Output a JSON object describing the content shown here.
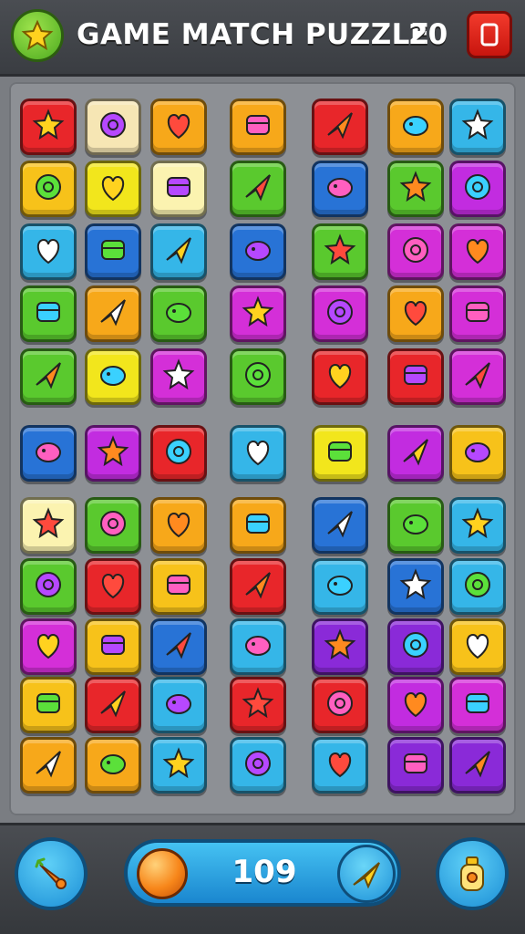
{
  "header": {
    "title": "GAME MATCH PUZZLE",
    "score": "20",
    "star_icon": "star-icon",
    "menu_icon": "menu-icon"
  },
  "footer": {
    "coins": "109",
    "left_button_icon": "carrot-icon",
    "orb_icon": "orange-orb-icon",
    "send_icon": "paper-plane-icon",
    "right_button_icon": "potion-bottle-icon"
  },
  "board": {
    "rows": 11,
    "cols": 7,
    "tiles": [
      [
        {
          "bg": "#e8262a",
          "icon": "blue-star-shard"
        },
        {
          "bg": "#f6e6b4",
          "icon": "map-piece"
        },
        {
          "bg": "#f7a81a",
          "icon": "orange-splat"
        },
        {
          "bg": "#f7a81a",
          "icon": "red-gem"
        },
        {
          "bg": "#e8262a",
          "icon": "folded-paper"
        },
        {
          "bg": "#f7a81a",
          "icon": "fox-head"
        },
        {
          "bg": "#35b6e8",
          "icon": "paint-brush"
        }
      ],
      [
        {
          "bg": "#f7c21a",
          "icon": "orange-star"
        },
        {
          "bg": "#f2e61c",
          "icon": "balloons"
        },
        {
          "bg": "#fbf3b0",
          "icon": "white-star"
        },
        {
          "bg": "#5ac92e",
          "icon": "red-button"
        },
        {
          "bg": "#2873d6",
          "icon": "red-leaf"
        },
        {
          "bg": "#5ac92e",
          "icon": "purple-heart"
        },
        {
          "bg": "#c22ce0",
          "icon": "orange-blob"
        }
      ],
      [
        {
          "bg": "#35b6e8",
          "icon": "cloud"
        },
        {
          "bg": "#2873d6",
          "icon": "wheel"
        },
        {
          "bg": "#35b6e8",
          "icon": "sun"
        },
        {
          "bg": "#2873d6",
          "icon": "bird"
        },
        {
          "bg": "#5ac92e",
          "icon": "ping-pong-paddle"
        },
        {
          "bg": "#d42fd8",
          "icon": "trumpet"
        },
        {
          "bg": "#d42fd8",
          "icon": "orange-slice"
        }
      ],
      [
        {
          "bg": "#5ac92e",
          "icon": "green-balloon"
        },
        {
          "bg": "#f7a81a",
          "icon": "pink-cone"
        },
        {
          "bg": "#5ac92e",
          "icon": "red-star"
        },
        {
          "bg": "#d42fd8",
          "icon": "pink-fish"
        },
        {
          "bg": "#d42fd8",
          "icon": "yellow-bird"
        },
        {
          "bg": "#f7a81a",
          "icon": "green-crystal"
        },
        {
          "bg": "#d42fd8",
          "icon": "pencil-tile"
        }
      ],
      [
        {
          "bg": "#5ac92e",
          "icon": "tree"
        },
        {
          "bg": "#f2e61c",
          "icon": "green-tree"
        },
        {
          "bg": "#d42fd8",
          "icon": "blue-ring"
        },
        {
          "bg": "#5ac92e",
          "icon": "cake"
        },
        {
          "bg": "#e8262a",
          "icon": "yellow-note"
        },
        {
          "bg": "#e8262a",
          "icon": "purple-cup"
        },
        {
          "bg": "#d42fd8",
          "icon": "orange-knot"
        }
      ],
      [
        {
          "bg": "#2873d6",
          "icon": "flower"
        },
        {
          "bg": "#c22ce0",
          "icon": "blue-egg"
        },
        {
          "bg": "#e8262a",
          "icon": "yellow-star"
        },
        {
          "bg": "#35b6e8",
          "icon": "green-grapes"
        },
        {
          "bg": "#f2e61c",
          "icon": "green-bone"
        },
        {
          "bg": "#c22ce0",
          "icon": "pink-dog"
        },
        {
          "bg": "#f7c21a",
          "icon": "orange-pencil"
        }
      ],
      [
        {
          "bg": "#fbf3b0",
          "icon": "snail"
        },
        {
          "bg": "#5ac92e",
          "icon": "camera"
        },
        {
          "bg": "#f7a81a",
          "icon": "blue-fish"
        },
        {
          "bg": "#f7a81a",
          "icon": "target"
        },
        {
          "bg": "#2873d6",
          "icon": "white-flag"
        },
        {
          "bg": "#5ac92e",
          "icon": "orange-boot"
        },
        {
          "bg": "#35b6e8",
          "icon": "pill"
        }
      ],
      [
        {
          "bg": "#5ac92e",
          "icon": "red-burst"
        },
        {
          "bg": "#e8262a",
          "icon": "gear"
        },
        {
          "bg": "#f7c21a",
          "icon": "bandage"
        },
        {
          "bg": "#e8262a",
          "icon": "blue-bubble"
        },
        {
          "bg": "#35b6e8",
          "icon": "speech-bubble"
        },
        {
          "bg": "#2873d6",
          "icon": "red-heart"
        },
        {
          "bg": "#35b6e8",
          "icon": "arrow"
        }
      ],
      [
        {
          "bg": "#d42fd8",
          "icon": "calendar"
        },
        {
          "bg": "#f7c21a",
          "icon": "blue-heart"
        },
        {
          "bg": "#2873d6",
          "icon": "green-plane"
        },
        {
          "bg": "#35b6e8",
          "icon": "cheese"
        },
        {
          "bg": "#8a2ad8",
          "icon": "red-block"
        },
        {
          "bg": "#8a2ad8",
          "icon": "spoon"
        },
        {
          "bg": "#f7c21a",
          "icon": "green-lollipop"
        }
      ],
      [
        {
          "bg": "#f7c21a",
          "icon": "orange-snail"
        },
        {
          "bg": "#e8262a",
          "icon": "red-blob"
        },
        {
          "bg": "#35b6e8",
          "icon": "red-ribbon"
        },
        {
          "bg": "#e8262a",
          "icon": "star-fold"
        },
        {
          "bg": "#e8262a",
          "icon": "green-plane-tile"
        },
        {
          "bg": "#c22ce0",
          "icon": "red-apple"
        },
        {
          "bg": "#d42fd8",
          "icon": "spiral"
        }
      ],
      [
        {
          "bg": "#f7a81a",
          "icon": "green-star"
        },
        {
          "bg": "#f7a81a",
          "icon": "green-map"
        },
        {
          "bg": "#35b6e8",
          "icon": "blue-cup"
        },
        {
          "bg": "#35b6e8",
          "icon": "striped-shell"
        },
        {
          "bg": "#35b6e8",
          "icon": "lemon"
        },
        {
          "bg": "#8a2ad8",
          "icon": "yellow-pencil"
        },
        {
          "bg": "#8a2ad8",
          "icon": "green-pin"
        }
      ]
    ]
  }
}
